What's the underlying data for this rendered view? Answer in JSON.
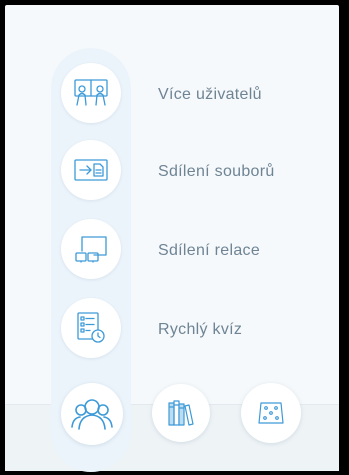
{
  "menu": {
    "items": [
      {
        "label": "Více uživatelů",
        "icon": "multi-user-icon"
      },
      {
        "label": "Sdílení souborů",
        "icon": "file-share-icon"
      },
      {
        "label": "Sdílení relace",
        "icon": "session-share-icon"
      },
      {
        "label": "Rychlý kvíz",
        "icon": "quick-quiz-icon"
      }
    ]
  },
  "bottom": {
    "buttons": [
      {
        "icon": "people-icon"
      },
      {
        "icon": "library-books-icon"
      },
      {
        "icon": "dice-icon"
      }
    ]
  },
  "colors": {
    "accent": "#4aa3df",
    "icon_stroke": "#3d9ad8",
    "label_text": "#6e8494",
    "rail_bg": "#ecf4fb",
    "frame": "#000000"
  }
}
